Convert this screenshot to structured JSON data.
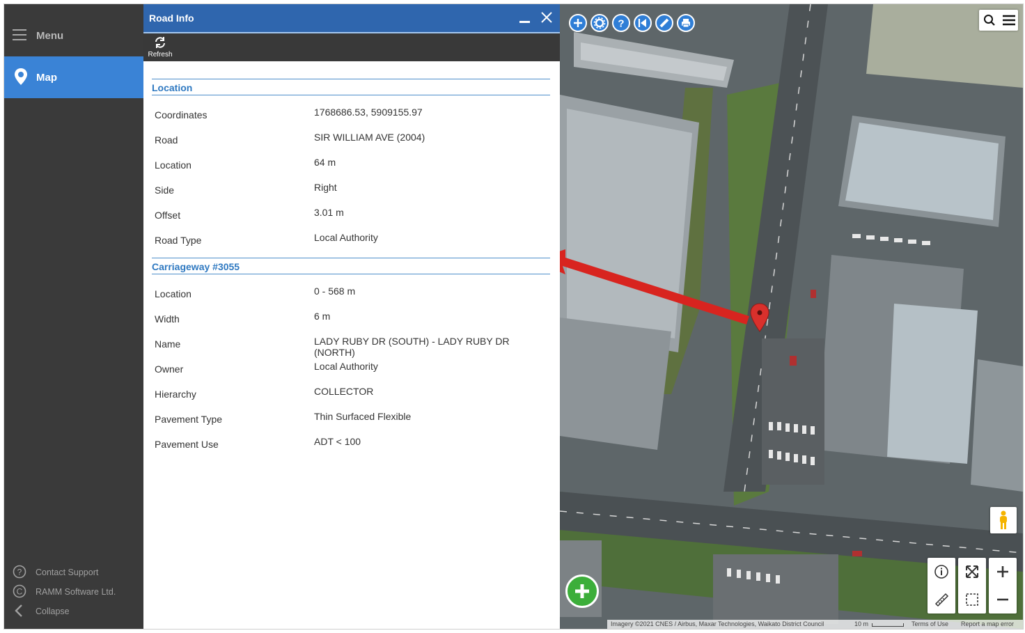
{
  "sidebar": {
    "menu_label": "Menu",
    "map_label": "Map",
    "footer": [
      {
        "label": "Contact Support",
        "icon": "question-circle-icon"
      },
      {
        "label": "RAMM Software Ltd.",
        "icon": "copyright-icon"
      },
      {
        "label": "Collapse",
        "icon": "chevron-left-icon"
      }
    ]
  },
  "panel": {
    "title": "Road Info",
    "refresh_label": "Refresh",
    "location_section": {
      "heading": "Location",
      "rows": [
        {
          "key": "Coordinates",
          "value": "1768686.53, 5909155.97"
        },
        {
          "key": "Road",
          "value": "SIR WILLIAM AVE (2004)"
        },
        {
          "key": "Location",
          "value": "64 m"
        },
        {
          "key": "Side",
          "value": "Right"
        },
        {
          "key": "Offset",
          "value": "3.01 m"
        },
        {
          "key": "Road Type",
          "value": "Local Authority"
        }
      ]
    },
    "carriageway_section": {
      "heading": "Carriageway #3055",
      "rows": [
        {
          "key": "Location",
          "value": "0 - 568 m"
        },
        {
          "key": "Width",
          "value": "6 m"
        },
        {
          "key": "Name",
          "value": "LADY RUBY DR (SOUTH) - LADY RUBY DR (NORTH)"
        },
        {
          "key": "Owner",
          "value": "Local Authority"
        },
        {
          "key": "Hierarchy",
          "value": "COLLECTOR"
        },
        {
          "key": "Pavement Type",
          "value": "Thin Surfaced Flexible"
        },
        {
          "key": "Pavement Use",
          "value": "ADT < 100"
        }
      ]
    }
  },
  "map": {
    "toolbar_icons": [
      "zoom-in-icon",
      "settings-icon",
      "help-icon",
      "back-icon",
      "measure-icon",
      "print-icon"
    ],
    "attribution": "Imagery ©2021 CNES / Airbus, Maxar Technologies, Waikato District Council",
    "scale": "10 m",
    "terms": "Terms of Use",
    "report": "Report a map error"
  },
  "colors": {
    "accent": "#3a83d6",
    "title_bar": "#2f66ae",
    "sidebar_bg": "#3a3a3a",
    "marker": "#d9302c",
    "add_button": "#3cae3a"
  }
}
